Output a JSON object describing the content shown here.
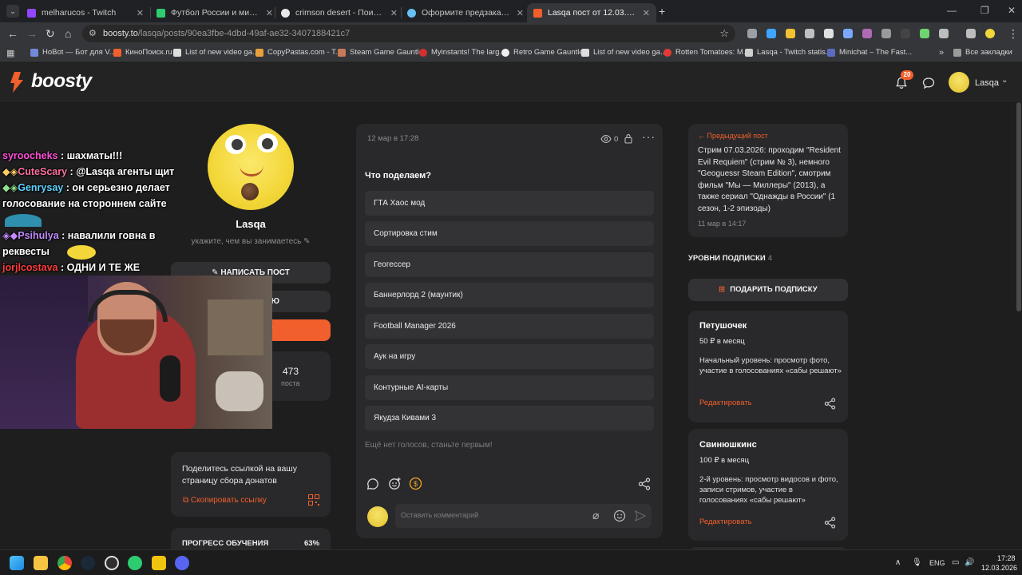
{
  "browser": {
    "tabs": [
      {
        "title": "melharucos - Twitch",
        "color": "#9146ff"
      },
      {
        "title": "Футбол России и мира 2026 - ·",
        "color": "#2ecc71"
      },
      {
        "title": "crimson desert - Поиск в Goog",
        "color": "#e8e8e8"
      },
      {
        "title": "Оформите предзаказ на Crimso",
        "color": "#1b2838"
      },
      {
        "title": "Lasqa пост от 12.03.2026 на Bo",
        "color": "#f15f2c"
      }
    ],
    "new_tab": "+",
    "url_host": "boosty.to",
    "url_path": "/lasqa/posts/90ea3fbe-4dbd-49af-ae32-3407188421c7",
    "ext_badge": "23",
    "bookmarks": [
      "HoBot — Бот для V...",
      "КиноПоиск.ru",
      "List of new video ga...",
      "CopyPastas.com - T...",
      "Steam Game Gauntlet",
      "Myinstants! The larg...",
      "Retro Game Gauntlet",
      "List of new video ga...",
      "Rotten Tomatoes: M...",
      "Lasqa - Twitch statis...",
      "Minichat – The Fast..."
    ],
    "all_bookmarks": "Все закладки"
  },
  "site": {
    "logo": "boosty",
    "notif_count": "20",
    "username": "Lasqa"
  },
  "profile": {
    "name": "Lasqa",
    "desc": "укажите, чем вы занимаетесь",
    "btn_write": "НАПИСАТЬ ПОСТ",
    "btn_stream": "СЛЯЦИЮ",
    "btn_blog": "ОГ",
    "posts_count": "473",
    "posts_label": "поста",
    "share_text": "Поделитесь ссылкой на вашу страницу сбора донатов",
    "copy_link": "Скопировать ссылку",
    "progress_label": "ПРОГРЕСС ОБУЧЕНИЯ",
    "progress_value": "63%"
  },
  "post": {
    "date": "12 мар в 17:28",
    "views": "0",
    "question": "Что поделаем?",
    "options": [
      "ГТА Хаос мод",
      "Сортировка стим",
      "Геогессер",
      "Баннерлорд 2 (маунтик)",
      "Football Manager 2026",
      "Аук на игру",
      "Контурные AI-карты",
      "Якудза Кивами 3"
    ],
    "no_votes": "Ещё нет голосов, станьте первым!",
    "comment_placeholder": "Оставить комментарий"
  },
  "sidebar": {
    "prev_label": "Предыдущий пост",
    "prev_text": "Стрим 07.03.2026: проходим \"Resident Evil Requiem\" (стрим № 3), немного \"Geoguessr Steam Edition\", смотрим фильм \"Мы — Миллеры\" (2013), а также сериал \"Однажды в России\" (1 сезон, 1-2 эпизоды)",
    "prev_date": "11 мар в 14:17",
    "levels_title": "УРОВНИ ПОДПИСКИ",
    "levels_count": "4",
    "gift_btn": "ПОДАРИТЬ ПОДПИСКУ",
    "tiers": [
      {
        "name": "Петушочек",
        "price": "50 ₽ в месяц",
        "desc": "Начальный уровень: просмотр фото, участие в голосованиях «сабы решают»",
        "edit": "Редактировать"
      },
      {
        "name": "Свинюшкинс",
        "price": "100 ₽ в месяц",
        "desc": "2-й уровень: просмотр видосов и фото, записи стримов, участие в голосованиях «сабы решают»",
        "edit": "Редактировать"
      }
    ]
  },
  "overlay": {
    "chat": [
      {
        "user": "syroocheks",
        "msg": "шахматы!!!",
        "color": "#ff4fd8"
      },
      {
        "user": "CuteScary",
        "msg": "@Lasqa агенты щит",
        "color": "#ff6fa0",
        "mention": true
      },
      {
        "user": "Genrysay",
        "msg": "он серьезно делает",
        "color": "#5fd3ff"
      },
      {
        "user": "",
        "msg": "голосование на стороннем сайте",
        "color": "#ffffff"
      },
      {
        "user": "Psihulya",
        "msg": "навалили говна в",
        "color": "#c38bff"
      },
      {
        "user": "",
        "msg": "реквесты",
        "color": "#ffffff"
      },
      {
        "user": "jorjlcostava",
        "msg": "ОДНИ И ТЕ ЖЕ",
        "color": "#ff3b3b"
      }
    ]
  },
  "taskbar": {
    "lang": "ENG",
    "time": "17:28",
    "date": "12.03.2026"
  }
}
